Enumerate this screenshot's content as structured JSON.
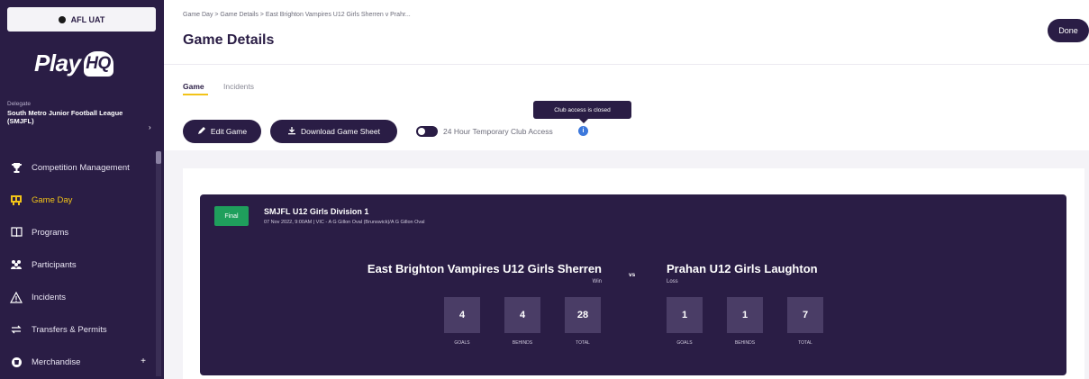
{
  "sidebar": {
    "env_label": "AFL UAT",
    "logo_text": "Play",
    "logo_badge": "HQ",
    "org_label": "Delegate",
    "org_name": "South Metro Junior Football League (SMJFL)",
    "items": [
      {
        "label": "Competition Management",
        "icon": "trophy-icon",
        "active": false
      },
      {
        "label": "Game Day",
        "icon": "scoreboard-icon",
        "active": true
      },
      {
        "label": "Programs",
        "icon": "book-icon",
        "active": false
      },
      {
        "label": "Participants",
        "icon": "people-icon",
        "active": false
      },
      {
        "label": "Incidents",
        "icon": "warning-icon",
        "active": false
      },
      {
        "label": "Transfers & Permits",
        "icon": "transfer-icon",
        "active": false
      },
      {
        "label": "Merchandise",
        "icon": "merchandise-icon",
        "active": false,
        "expandable": true
      }
    ],
    "expand_symbol": "+"
  },
  "header": {
    "breadcrumb": "Game Day  >  Game Details  >  East Brighton Vampires U12 Girls Sherren v Prahr...",
    "title": "Game Details",
    "done_label": "Done"
  },
  "tabs": [
    {
      "label": "Game",
      "active": true
    },
    {
      "label": "Incidents",
      "active": false
    }
  ],
  "actions": {
    "edit_label": "Edit Game",
    "download_label": "Download Game Sheet",
    "toggle_label": "24 Hour Temporary Club Access",
    "toggle_on": false,
    "info_symbol": "i",
    "tooltip": "Club access is closed"
  },
  "game": {
    "status": "Final",
    "competition": "SMJFL U12 Girls Division 1",
    "meta": "07 Nov 2022, 9:00AM | VIC - A G Gillon Oval (Brunswick)/A G Gillon Oval",
    "vs_label": "vs",
    "home": {
      "name": "East Brighton Vampires U12 Girls Sherren",
      "result": "Win",
      "scores": [
        {
          "value": "4",
          "label": "GOALS"
        },
        {
          "value": "4",
          "label": "BEHINDS"
        },
        {
          "value": "28",
          "label": "TOTAL"
        }
      ]
    },
    "away": {
      "name": "Prahan U12 Girls Laughton",
      "result": "Loss",
      "scores": [
        {
          "value": "1",
          "label": "GOALS"
        },
        {
          "value": "1",
          "label": "BEHINDS"
        },
        {
          "value": "7",
          "label": "TOTAL"
        }
      ]
    }
  },
  "colors": {
    "brand": "#2a1d45",
    "accent": "#f2c318",
    "final_badge": "#1f9f5c",
    "info": "#3c78dc"
  }
}
